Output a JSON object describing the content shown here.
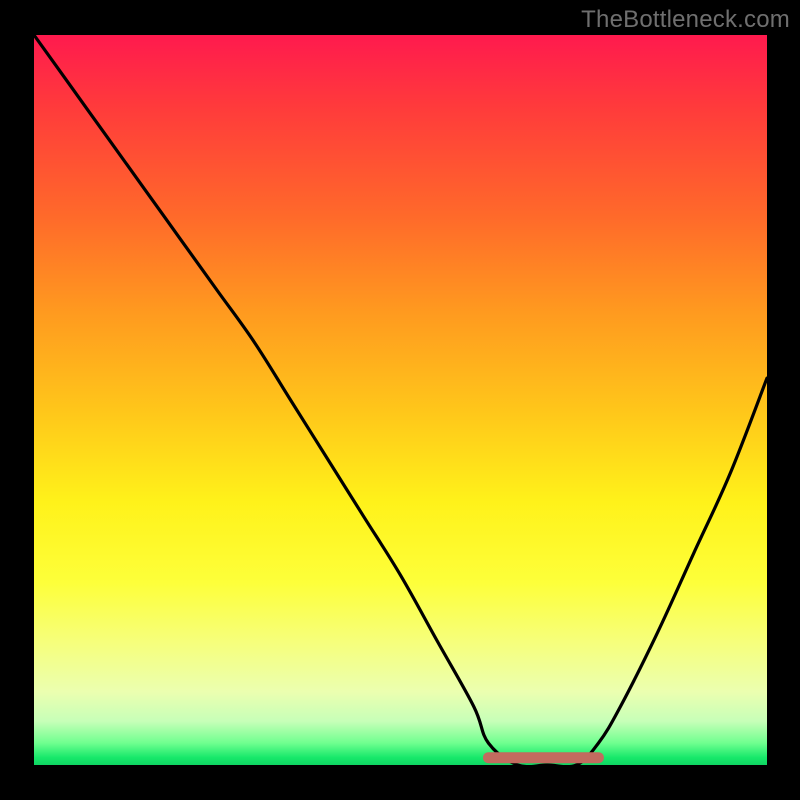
{
  "watermark": "TheBottleneck.com",
  "colors": {
    "background": "#000000",
    "gradient_top": "#ff1a4e",
    "gradient_bottom": "#0fd563",
    "curve": "#000000",
    "curve_bottom": "#c26b5f",
    "watermark_text": "#6f6f6f"
  },
  "chart_data": {
    "type": "line",
    "title": "",
    "xlabel": "",
    "ylabel": "",
    "xlim": [
      0,
      100
    ],
    "ylim": [
      0,
      100
    ],
    "series": [
      {
        "name": "bottleneck-curve",
        "x": [
          0,
          5,
          10,
          15,
          20,
          25,
          30,
          35,
          40,
          45,
          50,
          55,
          60,
          62,
          66,
          70,
          74,
          77,
          80,
          85,
          90,
          95,
          100
        ],
        "values": [
          100,
          93,
          86,
          79,
          72,
          65,
          58,
          50,
          42,
          34,
          26,
          17,
          8,
          3,
          0,
          0,
          0,
          3,
          8,
          18,
          29,
          40,
          53
        ]
      },
      {
        "name": "flat-bottom-highlight",
        "x": [
          62,
          66,
          70,
          74,
          77
        ],
        "values": [
          1,
          1,
          1,
          1,
          1
        ]
      }
    ],
    "annotations": []
  }
}
